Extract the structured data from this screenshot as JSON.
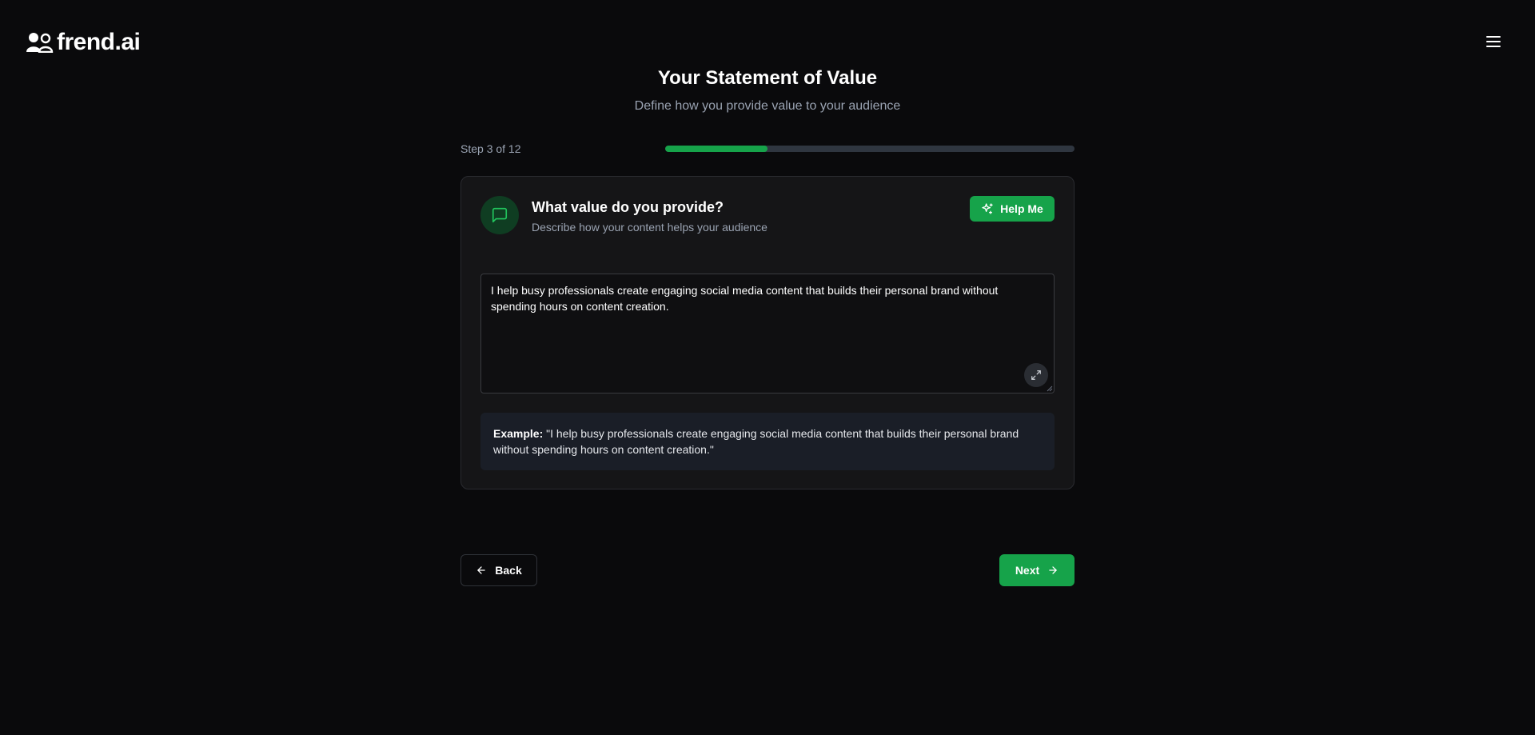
{
  "brand": {
    "name": "frend.ai",
    "logo_icon": "people-icon"
  },
  "header": {
    "menu_icon": "hamburger-menu-icon"
  },
  "page": {
    "title": "Your Statement of Value",
    "subtitle": "Define how you provide value to your audience"
  },
  "progress": {
    "label": "Step 3 of 12",
    "current_step": 3,
    "total_steps": 12,
    "fill_fraction": 0.25
  },
  "question": {
    "icon": "message-square-icon",
    "title": "What value do you provide?",
    "description": "Describe how your content helps your audience",
    "help_button_label": "Help Me",
    "help_icon": "sparkles-icon"
  },
  "answer": {
    "value": "I help busy professionals create engaging social media content that builds their personal brand without spending hours on content creation.",
    "expand_icon": "expand-icon"
  },
  "example": {
    "label": "Example:",
    "text": "\"I help busy professionals create engaging social media content that builds their personal brand without spending hours on content creation.\""
  },
  "navigation": {
    "back_label": "Back",
    "next_label": "Next",
    "back_icon": "arrow-left-icon",
    "next_icon": "arrow-right-icon"
  },
  "colors": {
    "background": "#0a0a0c",
    "card": "#151517",
    "accent": "#16a34a",
    "muted_text": "#9aa3b2",
    "example_bg": "#1a1e27"
  }
}
